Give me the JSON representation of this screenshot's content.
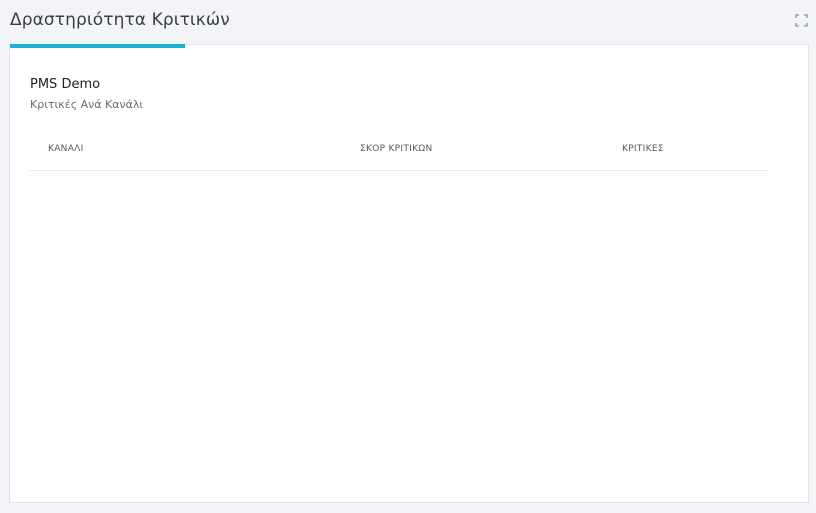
{
  "widget": {
    "title": "Δραστηριότητα Κριτικών",
    "accent_color": "#1ab0d1",
    "expand_icon": "expand-icon"
  },
  "panel": {
    "property_name": "PMS Demo",
    "subtitle": "Κριτικές Ανά Κανάλι"
  },
  "table": {
    "columns": [
      "ΚΑΝΑΛΙ",
      "ΣΚΟΡ ΚΡΙΤΙΚΩΝ",
      "ΚΡΙΤΙΚΕΣ"
    ],
    "rows": []
  }
}
